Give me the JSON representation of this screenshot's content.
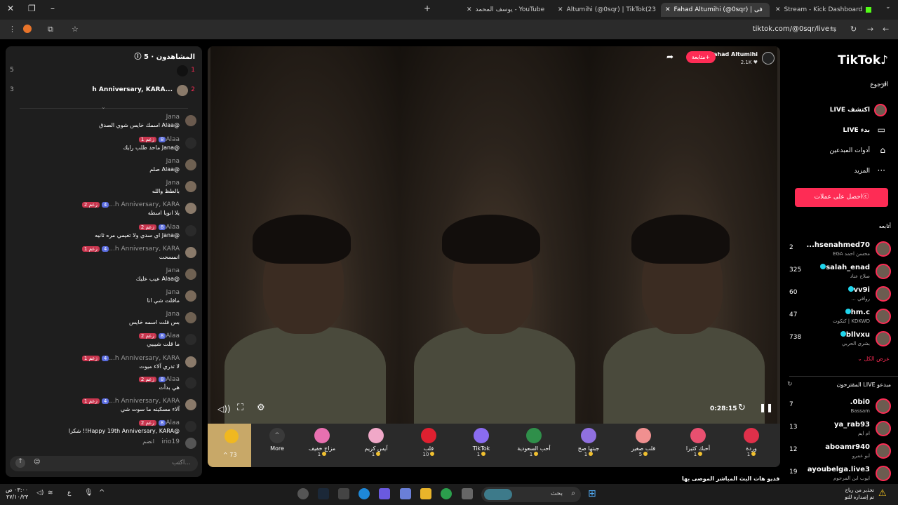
{
  "browser": {
    "tabs": [
      {
        "label": "Stream - Kick Dashboard"
      },
      {
        "label": "Fahad Altumihi (@0sqr) | فى"
      },
      {
        "label": "Altumihi (@0sqr) | TikTok(23)"
      },
      {
        "label": "يوسف المحمد - YouTube"
      }
    ],
    "url": "tiktok.com/@0sqr/live"
  },
  "chat": {
    "title": "المشاهدون · 5",
    "ranks": [
      {
        "rank": "1",
        "name": "",
        "score": "5"
      },
      {
        "rank": "2",
        "name": "h Anniversary, KARA...",
        "score": "3"
      }
    ],
    "messages": [
      {
        "name": "Jana",
        "badges": [],
        "text": "@Alaa اسمك خايس شوي الصدق"
      },
      {
        "name": "Alaa",
        "badges": [
          "8",
          "زعم 1"
        ],
        "text": "@Jana ماحد طلب رايك"
      },
      {
        "name": "Jana",
        "badges": [],
        "text": "@Alaa صلم"
      },
      {
        "name": "Jana",
        "badges": [],
        "text": "بالطظ والله"
      },
      {
        "name": "h Anniversary, KARA...",
        "badges": [
          "4",
          "زعم 2"
        ],
        "text": "يلا انويا اسطه"
      },
      {
        "name": "Alaa",
        "badges": [
          "8",
          "زعم 2"
        ],
        "text": "@Jana اي سدي ولا تغيمي مره ثانيه"
      },
      {
        "name": "h Anniversary, KARA...",
        "badges": [
          "4",
          "زعم 1"
        ],
        "text": "انمسحت"
      },
      {
        "name": "Jana",
        "badges": [],
        "text": "@Alaa عيب عليك"
      },
      {
        "name": "Jana",
        "badges": [],
        "text": "مافلت شي انا"
      },
      {
        "name": "Jana",
        "badges": [],
        "text": "بس قلت اسمه خايس"
      },
      {
        "name": "Alaa",
        "badges": [
          "8",
          "زعم 2"
        ],
        "text": "ما قلت شيييي"
      },
      {
        "name": "h Anniversary, KARA...",
        "badges": [
          "4",
          "زعم 1"
        ],
        "text": "لا تدري آلاء ميوت"
      },
      {
        "name": "Alaa",
        "badges": [
          "8",
          "زعم 2"
        ],
        "text": "هي بدأت"
      },
      {
        "name": "h Anniversary, KARA...",
        "badges": [
          "4",
          "زعم 1"
        ],
        "text": "آلاء مسكينه ما سوت شي"
      },
      {
        "name": "Alaa",
        "badges": [
          "8",
          "زعم 2"
        ],
        "text": "@Happy 19th Anniversary, KARA!! شكرا"
      },
      {
        "name": "irio19",
        "badges": [],
        "text": "انضم"
      }
    ],
    "input_placeholder": "اكتب..."
  },
  "video": {
    "host_name": "Fahad Altumihi",
    "host_likes": "2.1K",
    "follow_label": "+متابعة",
    "timer": "0:28:15",
    "coins": "73",
    "more_label": "More",
    "gifts": [
      {
        "name": "وردة",
        "price": "1",
        "color": "#e0304a"
      },
      {
        "name": "أحبك كثيرا",
        "price": "1",
        "color": "#e85070"
      },
      {
        "name": "قلب صغير",
        "price": "5",
        "color": "#f09090"
      },
      {
        "name": "جبتها صح",
        "price": "1",
        "color": "#9070e0"
      },
      {
        "name": "أحب السعودية",
        "price": "1",
        "color": "#2f8f4a"
      },
      {
        "name": "TikTok",
        "price": "1",
        "color": "#8a6cf0"
      },
      {
        "name": "قلب",
        "price": "10",
        "color": "#e02030"
      },
      {
        "name": "آيس كريم",
        "price": "1",
        "color": "#f0a8c8"
      },
      {
        "name": "مزاج خفيف",
        "price": "1",
        "color": "#e870b0"
      }
    ],
    "caption": "فديو هات البث المباشر الموصى بها"
  },
  "sidebar": {
    "logo": "TikTok",
    "back": "الرجوع",
    "nav": [
      "اكتشف LIVE",
      "بدء LIVE",
      "أدوات المبدعين",
      "المزيد"
    ],
    "coins_button": "احصل على عملات",
    "following_title": "أتابعه",
    "following": [
      {
        "name": "hsenahmed70...",
        "sub": "محسن احمد EGA",
        "count": "2"
      },
      {
        "name": "salah_enad",
        "sub": "صلاح عناد",
        "count": "325"
      },
      {
        "name": "vv9i",
        "sub": "روافي ...",
        "count": "60"
      },
      {
        "name": "hm.c",
        "sub": "KDKWD | كتكوت",
        "count": "47"
      },
      {
        "name": "bllvxu",
        "sub": "بشرى الحربي",
        "count": "738"
      }
    ],
    "show_all": "عرض الكل",
    "suggested_title": "مبدعو LIVE المقترحون",
    "suggested": [
      {
        "name": "0bi0.",
        "sub": "Bassam",
        "count": "7"
      },
      {
        "name": "ya_rab93",
        "sub": "ام ايم",
        "count": "13"
      },
      {
        "name": "aboamr940",
        "sub": "ابو عمرو",
        "count": "12"
      },
      {
        "name": "ayoubelga.live3",
        "sub": "ايوب ابن المرحوم",
        "count": "19"
      }
    ]
  },
  "taskbar": {
    "search_placeholder": "بحث",
    "notification": "تحذير من رياح",
    "notification_sub": "تم إصداره للتو",
    "time": "٠٣:٠٠ ص",
    "date": "٢٧/١٠/٢٣",
    "lang": "ع"
  }
}
